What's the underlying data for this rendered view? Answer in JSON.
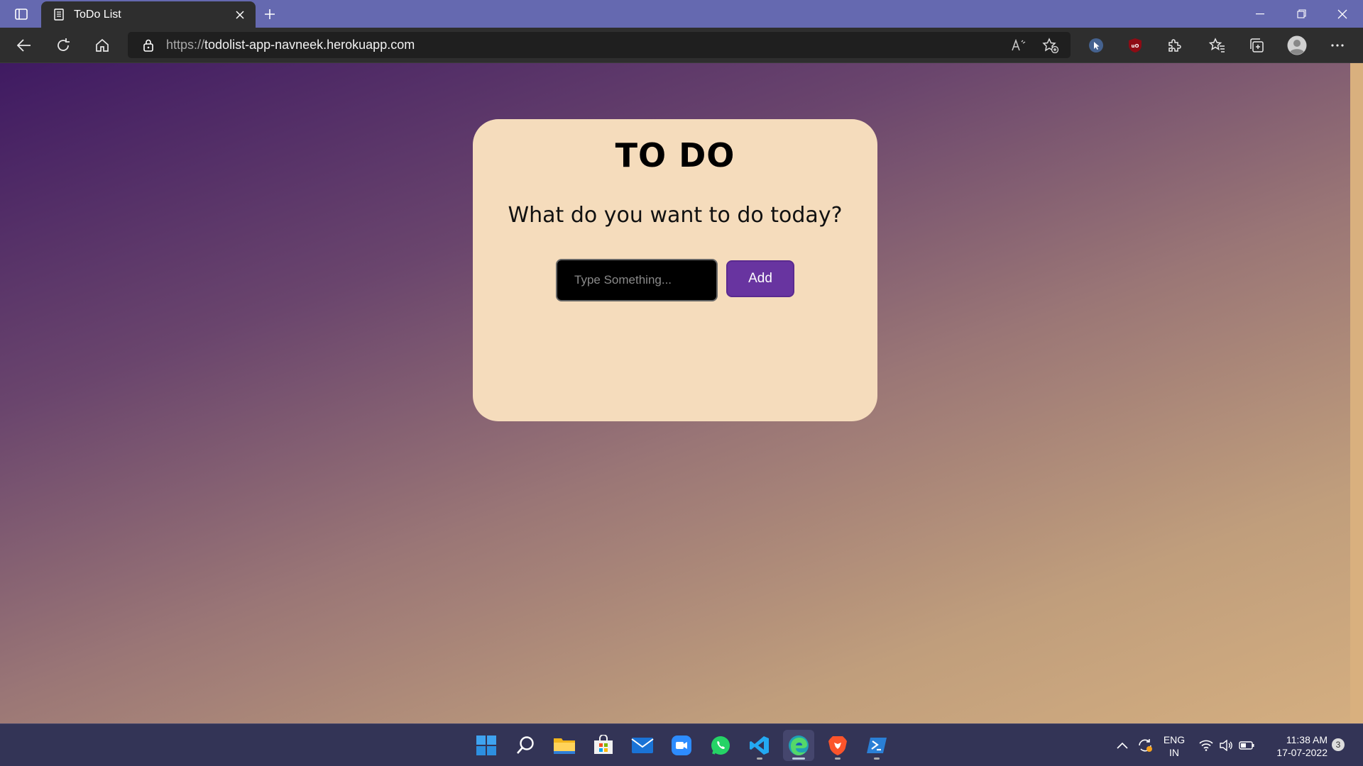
{
  "browser": {
    "tab_title": "ToDo List",
    "url_protocol": "https://",
    "url_host": "todolist-app-navneek.herokuapp.com",
    "icons": [
      "tab-actions-icon",
      "page-favicon-icon",
      "close-icon",
      "plus-icon",
      "minimize-icon",
      "restore-icon",
      "window-close-icon",
      "back-icon",
      "refresh-icon",
      "home-icon",
      "lock-icon",
      "read-aloud-icon",
      "add-favorite-icon",
      "extension-cursor-icon",
      "ublock-icon",
      "extensions-icon",
      "favorites-icon",
      "collections-icon",
      "profile-icon",
      "more-icon"
    ]
  },
  "app": {
    "title": "TO DO",
    "question": "What do you want to do today?",
    "input_placeholder": "Type Something...",
    "input_value": "",
    "add_label": "Add",
    "accent_color": "#6834a0",
    "card_color": "#f5dcbc"
  },
  "taskbar": {
    "apps": [
      "start-icon",
      "search-icon",
      "file-explorer-icon",
      "store-icon",
      "mail-icon",
      "zoom-icon",
      "whatsapp-icon",
      "vscode-icon",
      "edge-icon",
      "brave-icon",
      "powershell-icon"
    ],
    "lang_line1": "ENG",
    "lang_line2": "IN",
    "time": "11:38 AM",
    "date": "17-07-2022",
    "notification_count": "3"
  }
}
